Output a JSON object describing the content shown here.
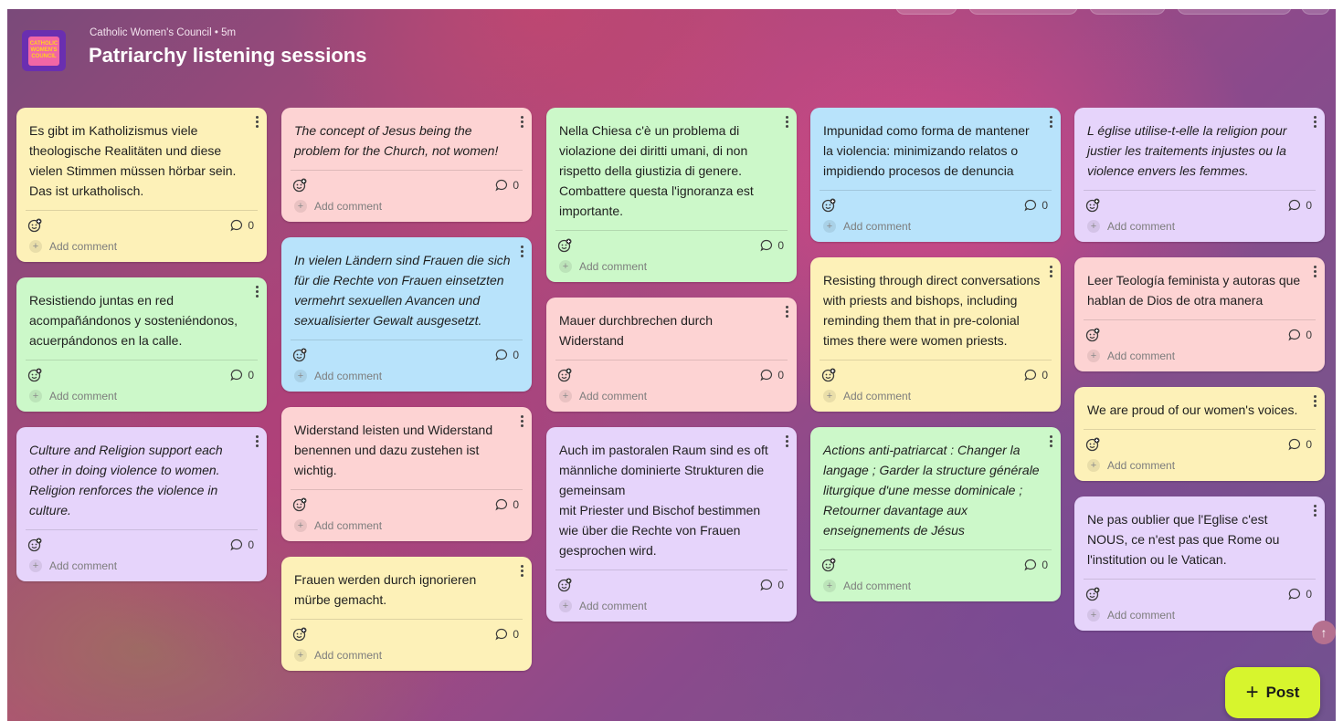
{
  "board": {
    "meta": "Catholic Women's Council • 5m",
    "title": "Patriarchy listening sessions",
    "logo_text": [
      "CATHOLIC",
      "WOMEN'S",
      "COUNCIL"
    ]
  },
  "card_labels": {
    "add_comment": "Add comment"
  },
  "post_button": {
    "label": "Post"
  },
  "colors": {
    "yellow": "#fdf1b8",
    "green": "#ccf8c9",
    "pink": "#fdd3d3",
    "blue": "#b8e3fb",
    "purple": "#e6d4fb",
    "post_button": "#d7f52d"
  },
  "columns": [
    {
      "cards": [
        {
          "text": "Es gibt im Katholizismus viele theologische Realitäten und diese vielen Stimmen müssen hörbar sein. Das ist urkatholisch.",
          "italic": false,
          "color": "yellow",
          "comments": "0"
        },
        {
          "text": "Resistiendo juntas en red acompañándonos y sosteniéndonos, acuerpándonos en la calle.",
          "italic": false,
          "color": "green",
          "comments": "0"
        },
        {
          "text": "Culture and Religion support each other in doing violence to women. Religion renforces the violence in culture.",
          "italic": true,
          "color": "purple",
          "comments": "0"
        }
      ]
    },
    {
      "cards": [
        {
          "text": "The concept of Jesus being the problem for the Church, not women!",
          "italic": true,
          "color": "pink",
          "comments": "0"
        },
        {
          "text": "In vielen Ländern sind Frauen die sich für die Rechte von Frauen einsetzten vermehrt sexuellen Avancen und sexualisierter Gewalt ausgesetzt.",
          "italic": true,
          "color": "blue",
          "comments": "0"
        },
        {
          "text": "Widerstand leisten und Widerstand benennen und dazu zustehen ist wichtig.",
          "italic": false,
          "color": "pink",
          "comments": "0"
        },
        {
          "text": "Frauen werden durch ignorieren mürbe gemacht.",
          "italic": false,
          "color": "yellow",
          "comments": "0"
        }
      ]
    },
    {
      "cards": [
        {
          "text": "Nella Chiesa c'è un problema di violazione dei diritti umani, di non rispetto della giustizia di genere. Combattere questa l'ignoranza est importante.",
          "italic": false,
          "color": "green",
          "comments": "0"
        },
        {
          "text": "Mauer durchbrechen durch Widerstand",
          "italic": false,
          "color": "pink",
          "comments": "0"
        },
        {
          "text": "Auch im pastoralen Raum sind es oft männliche dominierte Strukturen die gemeinsam\nmit Priester und Bischof bestimmen wie über die Rechte von Frauen gesprochen wird.",
          "italic": false,
          "color": "purple",
          "comments": "0"
        }
      ]
    },
    {
      "cards": [
        {
          "text": "Impunidad como forma de mantener la violencia: minimizando relatos o impidiendo procesos de denuncia",
          "italic": false,
          "color": "blue",
          "comments": "0"
        },
        {
          "text": "Resisting through direct conversations with priests and bishops, including reminding them that in pre-colonial times there were women priests.",
          "italic": false,
          "color": "yellow",
          "comments": "0"
        },
        {
          "text": "Actions anti-patriarcat : Changer la langage ; Garder la structure générale liturgique d'une messe dominicale ; Retourner davantage aux enseignements de Jésus",
          "italic": true,
          "color": "green",
          "comments": "0"
        }
      ]
    },
    {
      "cards": [
        {
          "text": "L église utilise-t-elle la religion pour justier les traitements injustes ou la violence envers les femmes.",
          "italic": true,
          "color": "purple",
          "comments": "0"
        },
        {
          "text": "Leer Teología feminista y autoras que hablan de Dios de otra manera",
          "italic": false,
          "color": "pink",
          "comments": "0"
        },
        {
          "text": "We are proud of our women's voices.",
          "italic": false,
          "color": "yellow",
          "comments": "0"
        },
        {
          "text": "Ne pas oublier que l'Eglise c'est NOUS, ce n'est pas que Rome ou l'institution ou le Vatican.",
          "italic": false,
          "color": "purple",
          "comments": "0"
        }
      ]
    }
  ]
}
